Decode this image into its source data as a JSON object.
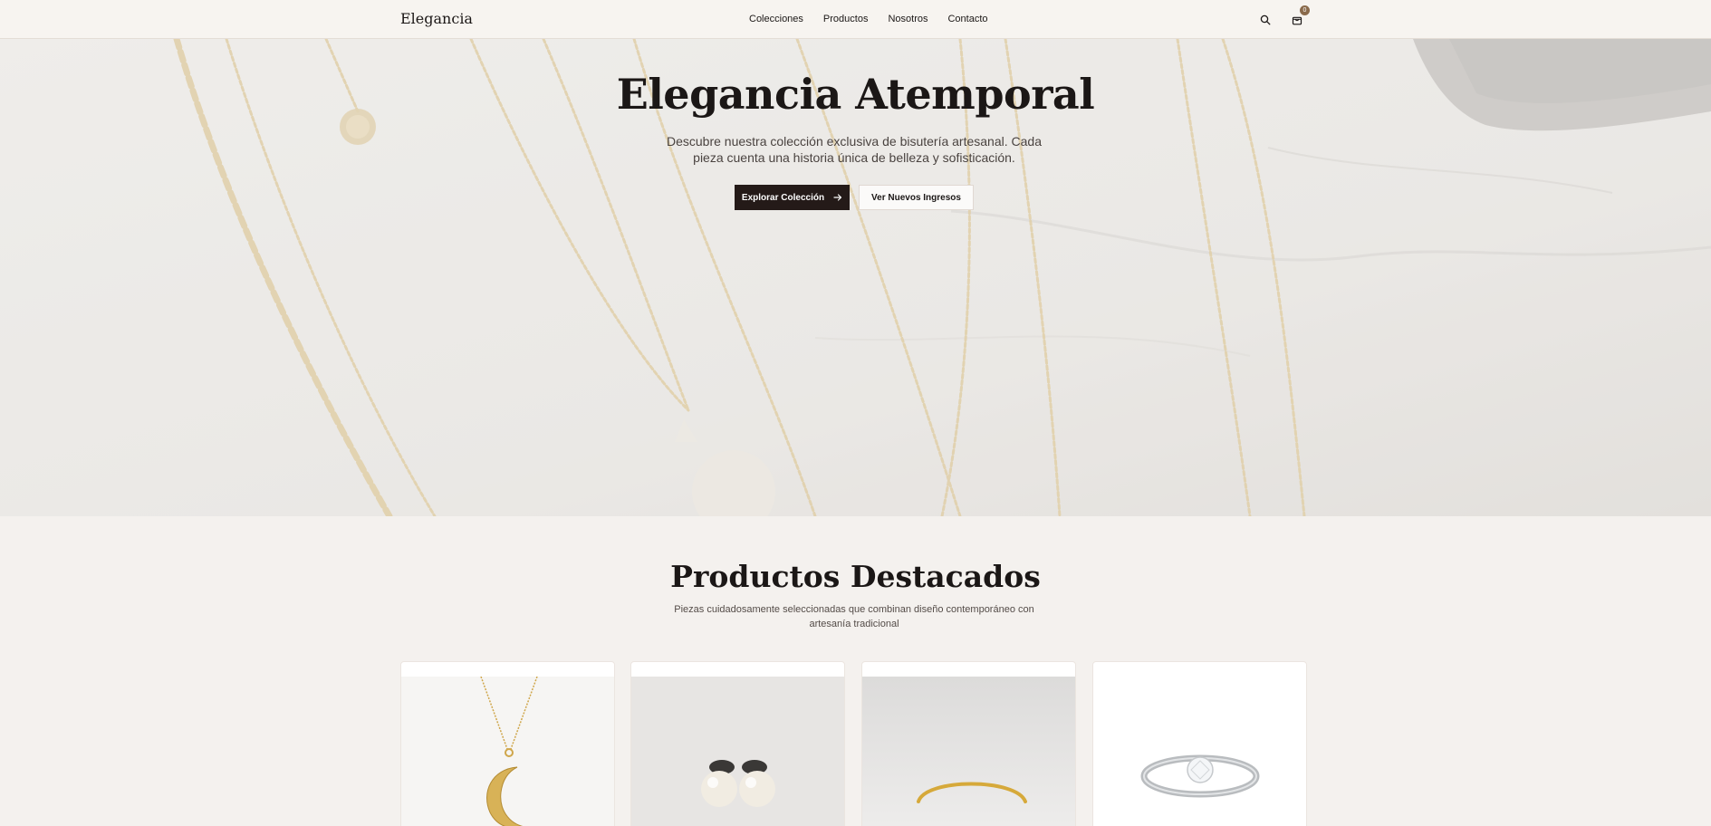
{
  "brand": "Elegancia",
  "nav": [
    "Colecciones",
    "Productos",
    "Nosotros",
    "Contacto"
  ],
  "header": {
    "search_icon": "search-icon",
    "cart_icon": "shopping-bag-icon",
    "cart_count": "0"
  },
  "hero": {
    "title": "Elegancia Atemporal",
    "subtitle": "Descubre nuestra colección exclusiva de bisutería artesanal. Cada pieza cuenta una historia única de belleza y sofisticación.",
    "primary_cta": "Explorar Colección",
    "secondary_cta": "Ver Nuevos Ingresos",
    "primary_cta_icon": "arrow-right-icon"
  },
  "featured": {
    "title": "Productos Destacados",
    "subtitle": "Piezas cuidadosamente seleccionadas que combinan diseño contemporáneo con artesanía tradicional",
    "product_images": [
      "crescent-moon-pendant-necklace",
      "pearl-stud-earrings",
      "gold-cuff-bracelet",
      "diamond-solitaire-ring"
    ]
  },
  "colors": {
    "background": "#f4f1ee",
    "primary_button": "#241a18",
    "gold": "#d8bf8a",
    "badge": "#8a6a4b"
  }
}
